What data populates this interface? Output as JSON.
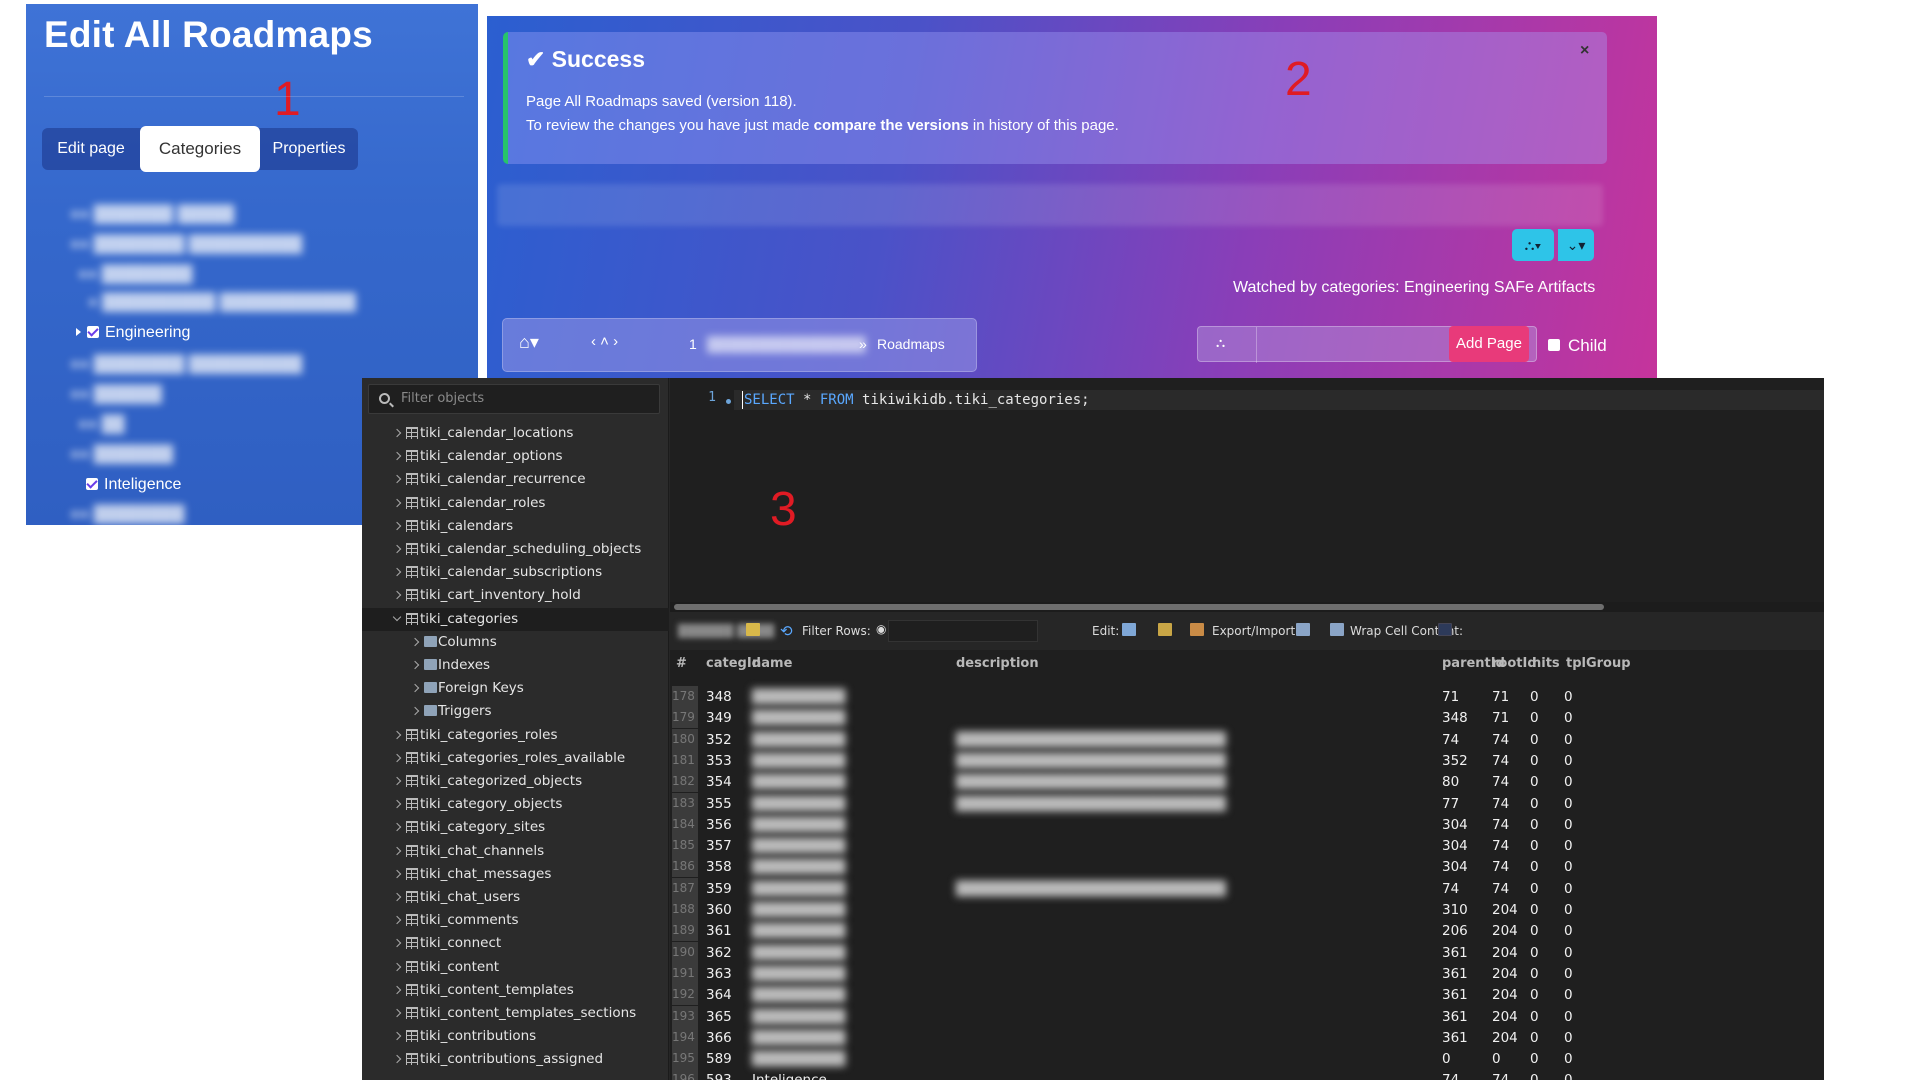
{
  "annotations": {
    "one": "1",
    "two": "2",
    "three": "3"
  },
  "panel1": {
    "title": "Edit All Roadmaps",
    "tabs": [
      "Edit page",
      "Categories",
      "Properties"
    ],
    "active_tab": "Categories",
    "categories": [
      {
        "label": "Engineering",
        "checked": true
      },
      {
        "label": "Inteligence",
        "checked": true
      }
    ]
  },
  "panel2": {
    "success_title": "Success",
    "close": "×",
    "message_line1": "Page All Roadmaps saved (version 118).",
    "message_line2_prefix": "To review the changes you have just made ",
    "message_line2_bold": "compare the versions",
    "message_line2_suffix": " in history of this page.",
    "watched": "Watched by categories: Engineering  SAFe Artifacts",
    "breadcrumb": {
      "number": "1",
      "separator": "»",
      "current": "Roadmaps"
    },
    "add_page_label": "Add Page",
    "child_label": "Child"
  },
  "panel3": {
    "filter_placeholder": "Filter objects",
    "tree": [
      {
        "label": "tiki_calendar_locations",
        "type": "table"
      },
      {
        "label": "tiki_calendar_options",
        "type": "table"
      },
      {
        "label": "tiki_calendar_recurrence",
        "type": "table"
      },
      {
        "label": "tiki_calendar_roles",
        "type": "table"
      },
      {
        "label": "tiki_calendars",
        "type": "table"
      },
      {
        "label": "tiki_calendar_scheduling_objects",
        "type": "table"
      },
      {
        "label": "tiki_calendar_subscriptions",
        "type": "table"
      },
      {
        "label": "tiki_cart_inventory_hold",
        "type": "table"
      },
      {
        "label": "tiki_categories",
        "type": "table",
        "open": true,
        "selected": true
      },
      {
        "label": "Columns",
        "type": "folder"
      },
      {
        "label": "Indexes",
        "type": "folder"
      },
      {
        "label": "Foreign Keys",
        "type": "folder"
      },
      {
        "label": "Triggers",
        "type": "folder"
      },
      {
        "label": "tiki_categories_roles",
        "type": "table"
      },
      {
        "label": "tiki_categories_roles_available",
        "type": "table"
      },
      {
        "label": "tiki_categorized_objects",
        "type": "table"
      },
      {
        "label": "tiki_category_objects",
        "type": "table"
      },
      {
        "label": "tiki_category_sites",
        "type": "table"
      },
      {
        "label": "tiki_chat_channels",
        "type": "table"
      },
      {
        "label": "tiki_chat_messages",
        "type": "table"
      },
      {
        "label": "tiki_chat_users",
        "type": "table"
      },
      {
        "label": "tiki_comments",
        "type": "table"
      },
      {
        "label": "tiki_connect",
        "type": "table"
      },
      {
        "label": "tiki_content",
        "type": "table"
      },
      {
        "label": "tiki_content_templates",
        "type": "table"
      },
      {
        "label": "tiki_content_templates_sections",
        "type": "table"
      },
      {
        "label": "tiki_contributions",
        "type": "table"
      },
      {
        "label": "tiki_contributions_assigned",
        "type": "table"
      }
    ],
    "editor": {
      "line_number": "1",
      "keyword1": "SELECT",
      "middle": " * ",
      "keyword2": "FROM",
      "rest": " tikiwikidb.tiki_categories;"
    },
    "toolbar": {
      "filter_rows": "Filter Rows:",
      "edit": "Edit:",
      "export_import": "Export/Import:",
      "wrap": "Wrap Cell Content:"
    },
    "columns": [
      "#",
      "categId",
      "name",
      "description",
      "parentId",
      "rootId",
      "hits",
      "tplGroup"
    ],
    "rows": [
      {
        "n": "178",
        "id": "348",
        "parent": "71",
        "root": "71",
        "hits": "0",
        "tpl": "0"
      },
      {
        "n": "179",
        "id": "349",
        "parent": "348",
        "root": "71",
        "hits": "0",
        "tpl": "0"
      },
      {
        "n": "180",
        "id": "352",
        "parent": "74",
        "root": "74",
        "hits": "0",
        "tpl": "0"
      },
      {
        "n": "181",
        "id": "353",
        "parent": "352",
        "root": "74",
        "hits": "0",
        "tpl": "0"
      },
      {
        "n": "182",
        "id": "354",
        "parent": "80",
        "root": "74",
        "hits": "0",
        "tpl": "0"
      },
      {
        "n": "183",
        "id": "355",
        "parent": "77",
        "root": "74",
        "hits": "0",
        "tpl": "0"
      },
      {
        "n": "184",
        "id": "356",
        "parent": "304",
        "root": "74",
        "hits": "0",
        "tpl": "0"
      },
      {
        "n": "185",
        "id": "357",
        "parent": "304",
        "root": "74",
        "hits": "0",
        "tpl": "0"
      },
      {
        "n": "186",
        "id": "358",
        "parent": "304",
        "root": "74",
        "hits": "0",
        "tpl": "0"
      },
      {
        "n": "187",
        "id": "359",
        "parent": "74",
        "root": "74",
        "hits": "0",
        "tpl": "0"
      },
      {
        "n": "188",
        "id": "360",
        "parent": "310",
        "root": "204",
        "hits": "0",
        "tpl": "0"
      },
      {
        "n": "189",
        "id": "361",
        "parent": "206",
        "root": "204",
        "hits": "0",
        "tpl": "0"
      },
      {
        "n": "190",
        "id": "362",
        "parent": "361",
        "root": "204",
        "hits": "0",
        "tpl": "0"
      },
      {
        "n": "191",
        "id": "363",
        "parent": "361",
        "root": "204",
        "hits": "0",
        "tpl": "0"
      },
      {
        "n": "192",
        "id": "364",
        "parent": "361",
        "root": "204",
        "hits": "0",
        "tpl": "0"
      },
      {
        "n": "193",
        "id": "365",
        "parent": "361",
        "root": "204",
        "hits": "0",
        "tpl": "0"
      },
      {
        "n": "194",
        "id": "366",
        "parent": "361",
        "root": "204",
        "hits": "0",
        "tpl": "0"
      },
      {
        "n": "195",
        "id": "589",
        "parent": "0",
        "root": "0",
        "hits": "0",
        "tpl": "0"
      },
      {
        "n": "196",
        "id": "593",
        "name": "Inteligence",
        "parent": "74",
        "root": "74",
        "hits": "0",
        "tpl": "0"
      }
    ],
    "colors": {
      "keyword": "#5aa8ff",
      "background": "#1f1f1f"
    }
  }
}
